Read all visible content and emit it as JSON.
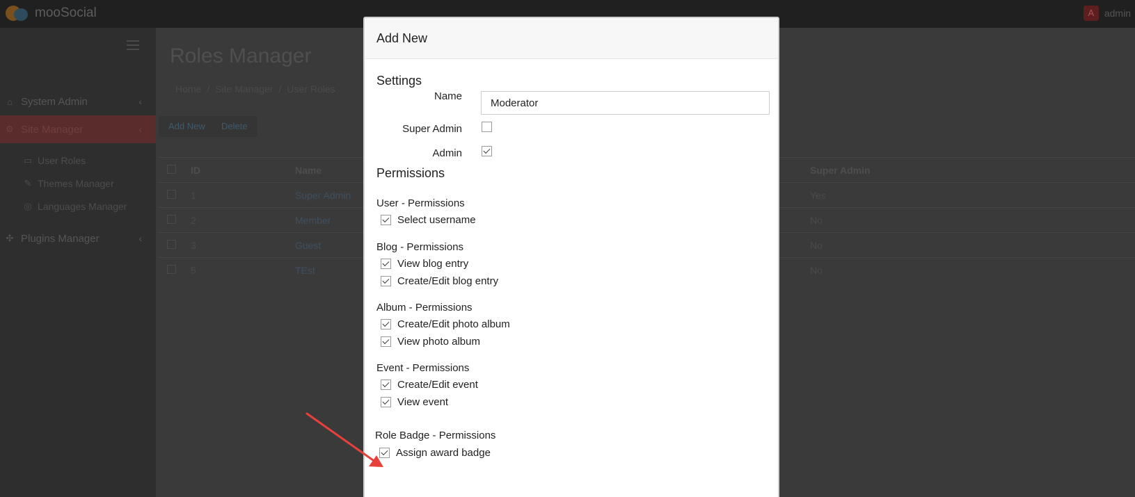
{
  "topbar": {
    "app_name": "mooSocial",
    "user_initial": "A",
    "user_name": "admin"
  },
  "sidebar": {
    "items": [
      {
        "label": "System Admin",
        "icon": "home-icon"
      },
      {
        "label": "Site Manager",
        "icon": "cogs-icon"
      },
      {
        "label": "Plugins Manager",
        "icon": "puzzle-icon"
      }
    ],
    "sub_items": [
      {
        "label": "User Roles",
        "icon": "id-card-icon"
      },
      {
        "label": "Themes Manager",
        "icon": "brush-icon"
      },
      {
        "label": "Languages Manager",
        "icon": "globe-icon"
      }
    ]
  },
  "main": {
    "title": "Roles Manager",
    "breadcrumb": [
      "Home",
      "Site Manager",
      "User Roles"
    ],
    "buttons": {
      "add_new": "Add New",
      "delete": "Delete"
    },
    "table": {
      "headers": {
        "id": "ID",
        "name": "Name",
        "super_admin": "Super Admin"
      },
      "rows": [
        {
          "id": "1",
          "name": "Super Admin",
          "super_admin": "Yes"
        },
        {
          "id": "2",
          "name": "Member",
          "super_admin": "No"
        },
        {
          "id": "3",
          "name": "Guest",
          "super_admin": "No"
        },
        {
          "id": "5",
          "name": "TEst",
          "super_admin": "No"
        }
      ]
    }
  },
  "modal": {
    "title": "Add New",
    "settings": {
      "heading": "Settings",
      "name_label": "Name",
      "name_value": "Moderator",
      "super_admin_label": "Super Admin",
      "super_admin_checked": false,
      "admin_label": "Admin",
      "admin_checked": true
    },
    "permissions_heading": "Permissions",
    "groups": [
      {
        "title": "User - Permissions",
        "items": [
          {
            "label": "Select username",
            "checked": true
          }
        ]
      },
      {
        "title": "Blog - Permissions",
        "items": [
          {
            "label": "View blog entry",
            "checked": true
          },
          {
            "label": "Create/Edit blog entry",
            "checked": true
          }
        ]
      },
      {
        "title": "Album - Permissions",
        "items": [
          {
            "label": "Create/Edit photo album",
            "checked": true
          },
          {
            "label": "View photo album",
            "checked": true
          }
        ]
      },
      {
        "title": "Event - Permissions",
        "items": [
          {
            "label": "Create/Edit event",
            "checked": true
          },
          {
            "label": "View event",
            "checked": true
          }
        ]
      },
      {
        "title": "Role Badge - Permissions",
        "items": [
          {
            "label": "Assign award badge",
            "checked": true
          }
        ]
      }
    ]
  },
  "annotation": {
    "arrow_color": "#e8413c"
  }
}
